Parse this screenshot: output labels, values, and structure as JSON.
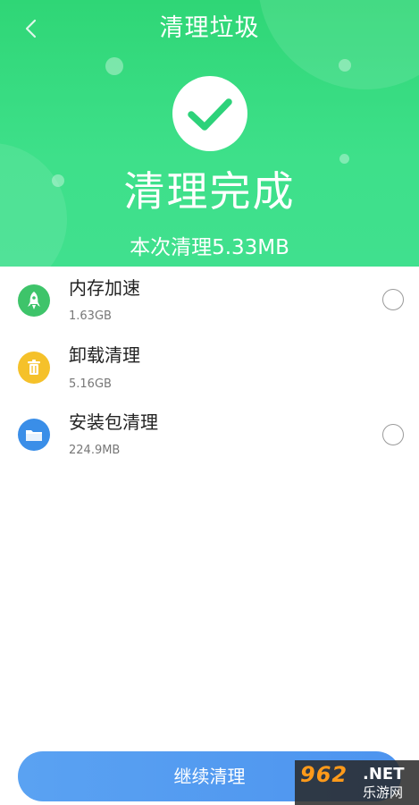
{
  "header": {
    "title": "清理垃圾",
    "status": "清理完成",
    "cleaned_summary": "本次清理5.33MB",
    "background_color": "#3ee08a"
  },
  "items": [
    {
      "name": "内存加速",
      "size": "1.63GB",
      "icon": "rocket-icon",
      "icon_color": "#3ec46a",
      "has_radio": true,
      "checked": false
    },
    {
      "name": "卸载清理",
      "size": "5.16GB",
      "icon": "trash-icon",
      "icon_color": "#f5c12a",
      "has_radio": false,
      "checked": false
    },
    {
      "name": "安装包清理",
      "size": "224.9MB",
      "icon": "folder-icon",
      "icon_color": "#3a8ee8",
      "has_radio": true,
      "checked": false
    }
  ],
  "button": {
    "label": "继续清理",
    "color": "#5aa2f2"
  },
  "watermark": {
    "logo": "962",
    "net": ".NET",
    "site": "乐游网"
  }
}
